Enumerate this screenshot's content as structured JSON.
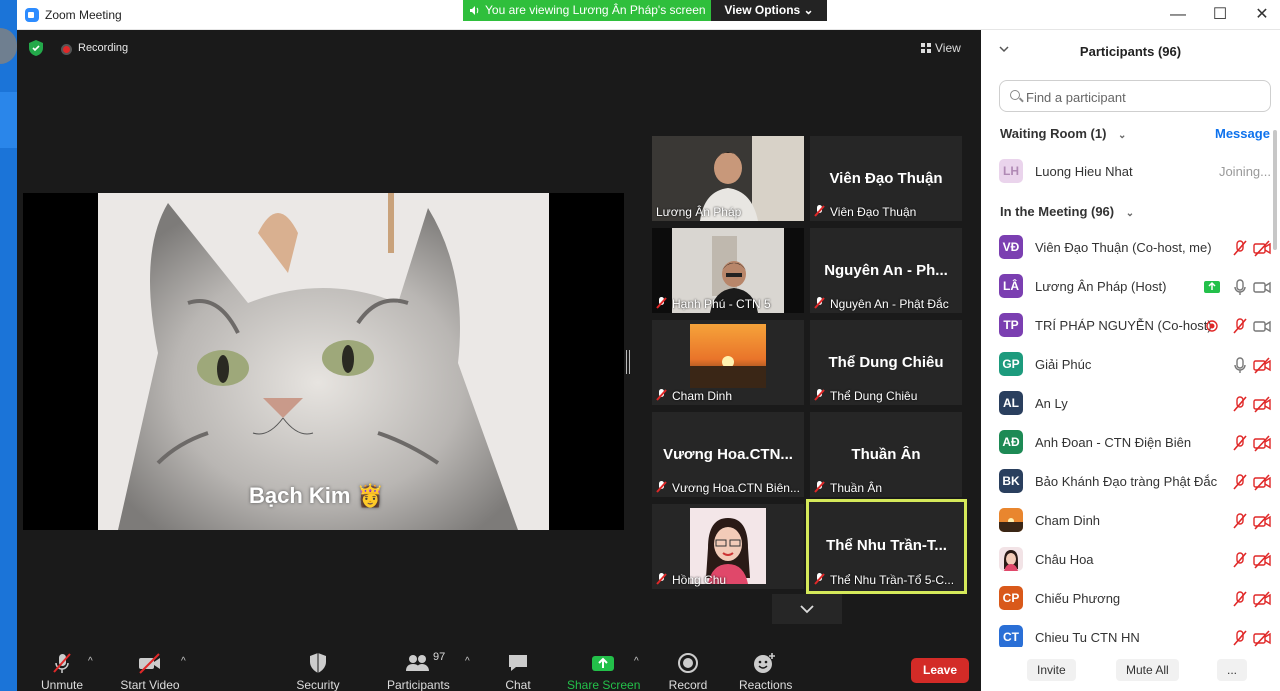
{
  "window": {
    "title": "Zoom Meeting",
    "viewing_banner": "You are viewing Lương Ân Pháp's screen",
    "view_options": "View Options ⌄",
    "minimize": "—",
    "maximize": "☐",
    "close": "✕"
  },
  "meeting": {
    "recording_label": "Recording",
    "view_label": "View",
    "shared_caption": "Bạch Kim 👸"
  },
  "tiles": [
    {
      "display": "",
      "label": "Lương Ân Pháp",
      "muted": false,
      "kind": "photo-person"
    },
    {
      "display": "Viên Đạo Thuận",
      "label": "Viên Đạo Thuận",
      "muted": true
    },
    {
      "display": "",
      "label": "Hạnh Phú - CTN 5",
      "muted": true,
      "kind": "photo-person2"
    },
    {
      "display": "Nguyên An - Ph...",
      "label": "Nguyên An - Phật Đắc",
      "muted": true
    },
    {
      "display": "",
      "label": "Cham Dinh",
      "muted": true,
      "kind": "photo-sunset"
    },
    {
      "display": "Thể Dung Chiêu",
      "label": "Thể Dung Chiêu",
      "muted": true
    },
    {
      "display": "Vương  Hoa.CTN...",
      "label": "Vương Hoa.CTN Biên...",
      "muted": true
    },
    {
      "display": "Thuần Ân",
      "label": "Thuần Ân",
      "muted": true
    },
    {
      "display": "",
      "label": "Hồng Chu",
      "muted": true,
      "kind": "photo-girl"
    },
    {
      "display": "Thể Nhu Trần-T...",
      "label": "Thể Nhu Trần-Tổ 5-C...",
      "muted": true
    }
  ],
  "toolbar": {
    "unmute": "Unmute",
    "start_video": "Start Video",
    "security": "Security",
    "participants": "Participants",
    "participants_count": "97",
    "chat": "Chat",
    "share_screen": "Share Screen",
    "record": "Record",
    "reactions": "Reactions",
    "leave": "Leave"
  },
  "panel": {
    "title": "Participants (96)",
    "search_placeholder": "Find a participant",
    "waiting_room": "Waiting Room (1)",
    "message": "Message",
    "waiting": [
      {
        "initials": "LH",
        "name": "Luong Hieu Nhat",
        "status": "Joining...",
        "color": "#e6c8e8"
      }
    ],
    "in_meeting": "In the Meeting (96)",
    "members": [
      {
        "initials": "VĐ",
        "name": "Viên Đạo Thuận (Co-host, me)",
        "color": "#7b3fb1"
      },
      {
        "initials": "LÂ",
        "name": "Lương Ân Pháp (Host)",
        "color": "#7b3fb1"
      },
      {
        "initials": "TP",
        "name": "TRÍ PHÁP NGUYỄN (Co-host)",
        "color": "#7b3fb1"
      },
      {
        "initials": "GP",
        "name": "Giải Phúc",
        "color": "#1d9b7d"
      },
      {
        "initials": "AL",
        "name": "An Ly",
        "color": "#2a3f5e"
      },
      {
        "initials": "AĐ",
        "name": "Anh Đoan - CTN Điện Biên",
        "color": "#1d8a55"
      },
      {
        "initials": "BK",
        "name": "Bảo Khánh Đạo tràng Phật Đắc",
        "color": "#2a3f5e"
      },
      {
        "initials": "",
        "name": "Cham Dinh",
        "color": "#c27220"
      },
      {
        "initials": "",
        "name": "Châu Hoa",
        "color": "#e7c3c9"
      },
      {
        "initials": "CP",
        "name": "Chiếu Phương",
        "color": "#d9591a"
      },
      {
        "initials": "CT",
        "name": "Chieu Tu CTN HN",
        "color": "#2a6fd6"
      }
    ],
    "invite": "Invite",
    "mute_all": "Mute All",
    "more": "..."
  }
}
